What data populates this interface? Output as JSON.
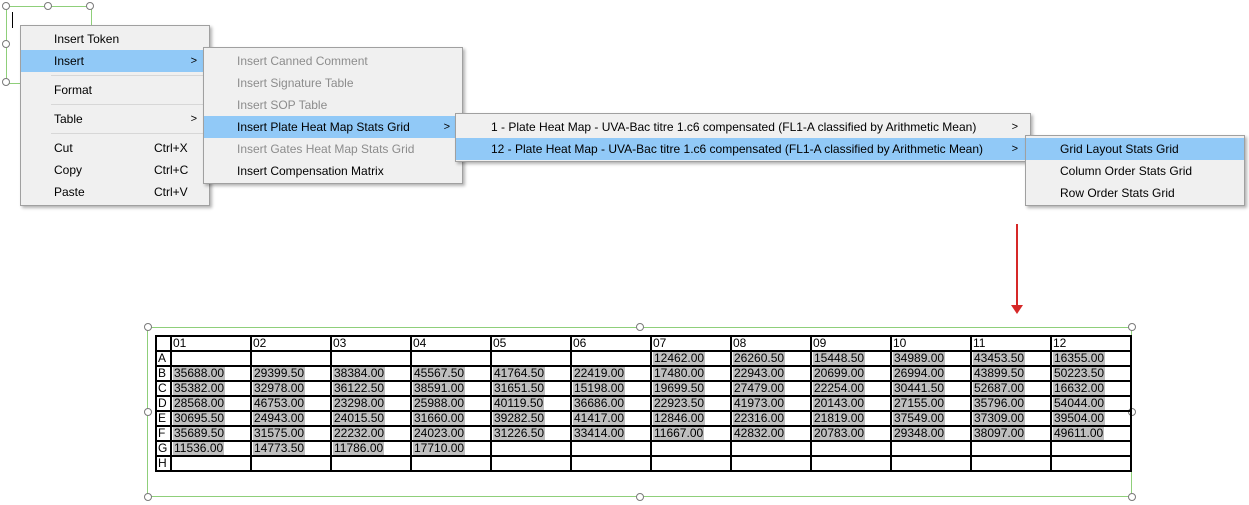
{
  "context_menu": {
    "items": [
      {
        "label": "Insert Token",
        "shortcut": "",
        "submenu": false,
        "highlighted": false
      },
      {
        "label": "Insert",
        "shortcut": "",
        "submenu": true,
        "highlighted": true
      },
      {
        "label": "Format",
        "shortcut": "",
        "submenu": false,
        "highlighted": false
      },
      {
        "label": "Table",
        "shortcut": "",
        "submenu": true,
        "highlighted": false
      },
      {
        "label": "Cut",
        "shortcut": "Ctrl+X",
        "submenu": false,
        "highlighted": false
      },
      {
        "label": "Copy",
        "shortcut": "Ctrl+C",
        "submenu": false,
        "highlighted": false
      },
      {
        "label": "Paste",
        "shortcut": "Ctrl+V",
        "submenu": false,
        "highlighted": false
      }
    ],
    "arrow_glyph": ">"
  },
  "insert_submenu": {
    "items": [
      {
        "label": "Insert Canned Comment",
        "disabled": true,
        "highlighted": false,
        "submenu": false
      },
      {
        "label": "Insert Signature Table",
        "disabled": true,
        "highlighted": false,
        "submenu": false
      },
      {
        "label": "Insert SOP Table",
        "disabled": true,
        "highlighted": false,
        "submenu": false
      },
      {
        "label": "Insert Plate Heat Map Stats Grid",
        "disabled": false,
        "highlighted": true,
        "submenu": true
      },
      {
        "label": "Insert Gates Heat Map Stats Grid",
        "disabled": true,
        "highlighted": false,
        "submenu": false
      },
      {
        "label": "Insert Compensation Matrix",
        "disabled": false,
        "highlighted": false,
        "submenu": false
      }
    ]
  },
  "heatmap_submenu": {
    "items": [
      {
        "label": "1 - Plate Heat Map - UVA-Bac titre 1.c6 compensated (FL1-A classified by Arithmetic Mean)",
        "highlighted": false
      },
      {
        "label": "12 - Plate Heat Map - UVA-Bac titre 1.c6 compensated (FL1-A classified by Arithmetic Mean)",
        "highlighted": true
      }
    ]
  },
  "grid_type_submenu": {
    "items": [
      {
        "label": "Grid Layout Stats Grid",
        "highlighted": true
      },
      {
        "label": "Column Order Stats Grid",
        "highlighted": false
      },
      {
        "label": "Row Order Stats Grid",
        "highlighted": false
      }
    ]
  },
  "colors": {
    "highlight": "#91c9f7",
    "selection_frame": "#8fcf7a",
    "arrow": "#d62828",
    "cell_value_bg": "#bfbfbf"
  },
  "stats_grid": {
    "columns": [
      "01",
      "02",
      "03",
      "04",
      "05",
      "06",
      "07",
      "08",
      "09",
      "10",
      "11",
      "12"
    ],
    "rows": [
      {
        "label": "A",
        "values": [
          "",
          "",
          "",
          "",
          "",
          "",
          "12462.00",
          "26260.50",
          "15448.50",
          "34989.00",
          "43453.50",
          "16355.00"
        ]
      },
      {
        "label": "B",
        "values": [
          "35688.00",
          "29399.50",
          "38384.00",
          "45567.50",
          "41764.50",
          "22419.00",
          "17480.00",
          "22943.00",
          "20699.00",
          "26994.00",
          "43899.50",
          "50223.50"
        ]
      },
      {
        "label": "C",
        "values": [
          "35382.00",
          "32978.00",
          "36122.50",
          "38591.00",
          "31651.50",
          "15198.00",
          "19699.50",
          "27479.00",
          "22254.00",
          "30441.50",
          "52687.00",
          "16632.00"
        ]
      },
      {
        "label": "D",
        "values": [
          "28568.00",
          "46753.00",
          "23298.00",
          "25988.00",
          "40119.50",
          "36686.00",
          "22923.50",
          "41973.00",
          "20143.00",
          "27155.00",
          "35796.00",
          "54044.00"
        ]
      },
      {
        "label": "E",
        "values": [
          "30695.50",
          "24943.00",
          "24015.50",
          "31660.00",
          "39282.50",
          "41417.00",
          "12846.00",
          "22316.00",
          "21819.00",
          "37549.00",
          "37309.00",
          "39504.00"
        ]
      },
      {
        "label": "F",
        "values": [
          "35689.50",
          "31575.00",
          "22232.00",
          "24023.00",
          "31226.50",
          "33414.00",
          "11667.00",
          "42832.00",
          "20783.00",
          "29348.00",
          "38097.00",
          "49611.00"
        ]
      },
      {
        "label": "G",
        "values": [
          "11536.00",
          "14773.50",
          "11786.00",
          "17710.00",
          "",
          "",
          "",
          "",
          "",
          "",
          "",
          ""
        ]
      },
      {
        "label": "H",
        "values": [
          "",
          "",
          "",
          "",
          "",
          "",
          "",
          "",
          "",
          "",
          "",
          ""
        ]
      }
    ]
  }
}
